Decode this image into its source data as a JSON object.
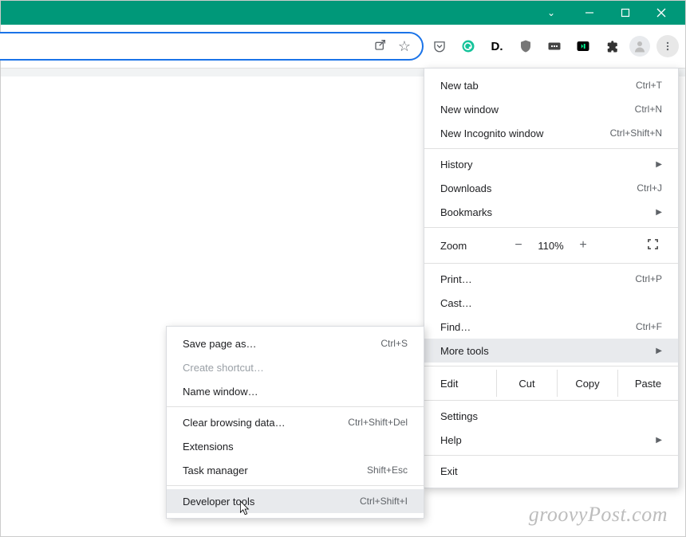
{
  "titlebar": {
    "chev": "⌄"
  },
  "omnibox": {
    "share": "↗",
    "star": "☆"
  },
  "extensions": {
    "pocket": "⌄",
    "grammarly": "G",
    "d": "D.",
    "ublock": "🛡",
    "dots": "⋯",
    "play": "▶",
    "puzzle": "✦"
  },
  "menu": {
    "new_tab": {
      "label": "New tab",
      "shortcut": "Ctrl+T"
    },
    "new_window": {
      "label": "New window",
      "shortcut": "Ctrl+N"
    },
    "new_incognito": {
      "label": "New Incognito window",
      "shortcut": "Ctrl+Shift+N"
    },
    "history": {
      "label": "History"
    },
    "downloads": {
      "label": "Downloads",
      "shortcut": "Ctrl+J"
    },
    "bookmarks": {
      "label": "Bookmarks"
    },
    "zoom": {
      "label": "Zoom",
      "minus": "−",
      "value": "110%",
      "plus": "+",
      "full": "⛶"
    },
    "print": {
      "label": "Print…",
      "shortcut": "Ctrl+P"
    },
    "cast": {
      "label": "Cast…"
    },
    "find": {
      "label": "Find…",
      "shortcut": "Ctrl+F"
    },
    "more_tools": {
      "label": "More tools"
    },
    "edit": {
      "label": "Edit",
      "cut": "Cut",
      "copy": "Copy",
      "paste": "Paste"
    },
    "settings": {
      "label": "Settings"
    },
    "help": {
      "label": "Help"
    },
    "exit": {
      "label": "Exit"
    }
  },
  "submenu": {
    "save_page": {
      "label": "Save page as…",
      "shortcut": "Ctrl+S"
    },
    "create_shortcut": {
      "label": "Create shortcut…"
    },
    "name_window": {
      "label": "Name window…"
    },
    "clear_data": {
      "label": "Clear browsing data…",
      "shortcut": "Ctrl+Shift+Del"
    },
    "extensions": {
      "label": "Extensions"
    },
    "task_manager": {
      "label": "Task manager",
      "shortcut": "Shift+Esc"
    },
    "dev_tools": {
      "label": "Developer tools",
      "shortcut": "Ctrl+Shift+I"
    }
  },
  "watermark": "groovyPost.com"
}
